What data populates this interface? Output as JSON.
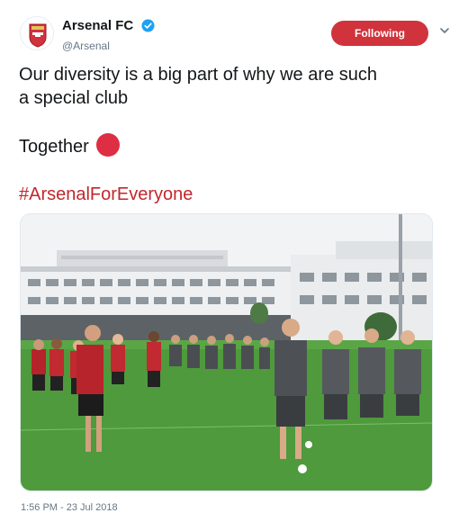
{
  "account": {
    "display_name": "Arsenal FC",
    "handle": "@Arsenal",
    "avatar_icon": "arsenal-crest-icon",
    "verified_icon": "verified-badge-icon",
    "verified_color": "#1da1f2"
  },
  "follow_button": {
    "label": "Following",
    "color": "#d0333c"
  },
  "menu_icon": "chevron-down-icon",
  "tweet": {
    "line1": "Our diversity is a big part of why we are such",
    "line2": "a special club",
    "together": "Together",
    "emoji": "red-circle-emoji",
    "hashtag": "#ArsenalForEveryone",
    "hashtag_color": "#c1272d"
  },
  "media": {
    "type": "photo"
  },
  "timestamp": "1:56 PM - 23 Jul 2018"
}
